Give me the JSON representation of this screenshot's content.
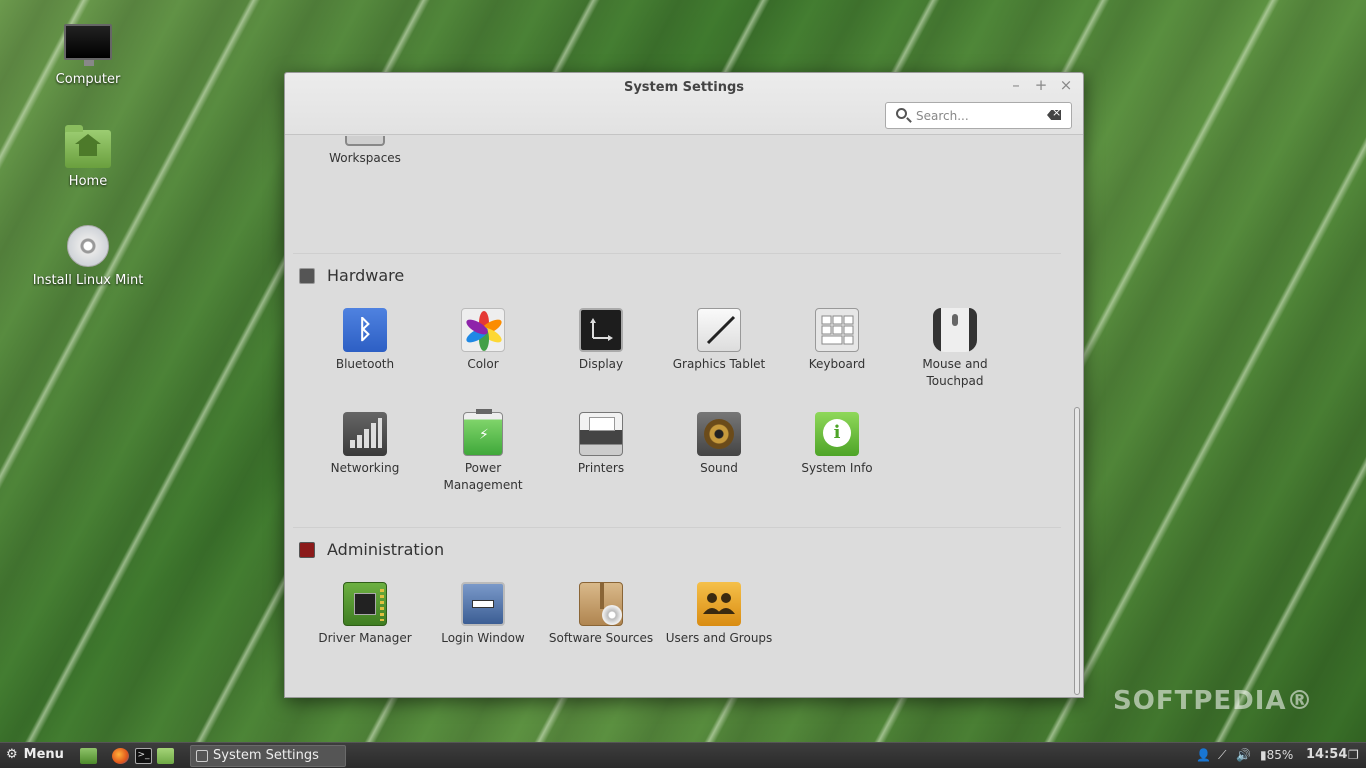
{
  "desktop": {
    "icons": [
      {
        "label": "Computer",
        "icon": "computer-icon"
      },
      {
        "label": "Home",
        "icon": "home-folder-icon"
      },
      {
        "label": "Install Linux Mint",
        "icon": "disc-icon"
      }
    ]
  },
  "window": {
    "title": "System Settings",
    "controls": {
      "minimize": "–",
      "maximize": "+",
      "close": "×"
    },
    "search": {
      "placeholder": "Search...",
      "value": ""
    },
    "partial_item": {
      "label": "Workspaces",
      "icon": "workspaces-icon"
    },
    "sections": [
      {
        "title": "Hardware",
        "icon": "hardware-icon",
        "items": [
          {
            "label": "Bluetooth",
            "icon": "bluetooth-icon"
          },
          {
            "label": "Color",
            "icon": "color-icon"
          },
          {
            "label": "Display",
            "icon": "display-icon"
          },
          {
            "label": "Graphics Tablet",
            "icon": "graphics-tablet-icon"
          },
          {
            "label": "Keyboard",
            "icon": "keyboard-icon"
          },
          {
            "label": "Mouse and Touchpad",
            "icon": "mouse-icon"
          },
          {
            "label": "Networking",
            "icon": "networking-icon"
          },
          {
            "label": "Power Management",
            "icon": "power-icon"
          },
          {
            "label": "Printers",
            "icon": "printer-icon"
          },
          {
            "label": "Sound",
            "icon": "sound-icon"
          },
          {
            "label": "System Info",
            "icon": "system-info-icon"
          }
        ]
      },
      {
        "title": "Administration",
        "icon": "administration-icon",
        "items": [
          {
            "label": "Driver Manager",
            "icon": "driver-manager-icon"
          },
          {
            "label": "Login Window",
            "icon": "login-window-icon"
          },
          {
            "label": "Software Sources",
            "icon": "software-sources-icon"
          },
          {
            "label": "Users and Groups",
            "icon": "users-groups-icon"
          }
        ]
      }
    ]
  },
  "taskbar": {
    "menu_label": "Menu",
    "task_label": "System Settings",
    "battery": "85%",
    "clock": "14:54"
  },
  "watermark": "SOFTPEDIA®",
  "colors": {
    "window_bg": "#dcdcdc",
    "taskbar_bg": "#2b2b2b",
    "bluetooth": "#2d5fc4",
    "system_info": "#5cb82e",
    "users_groups": "#e8a41e"
  }
}
